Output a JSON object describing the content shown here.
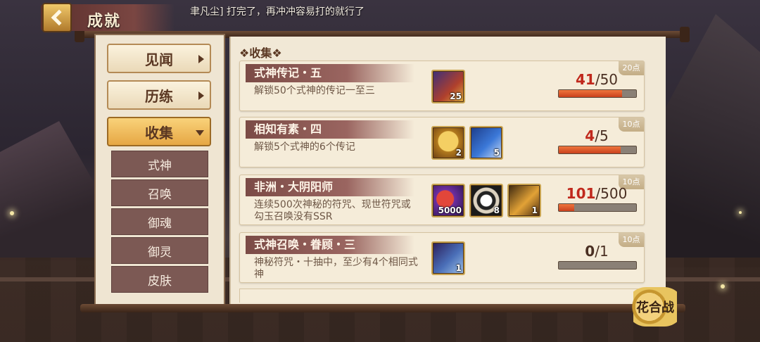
{
  "header": {
    "title": "成就",
    "ticker": "聿凡尘] 打完了，再冲冲容易打的就行了"
  },
  "nav": {
    "tabs": [
      {
        "label": "见闻"
      },
      {
        "label": "历练"
      },
      {
        "label": "收集"
      }
    ],
    "sub_items": [
      {
        "label": "式神"
      },
      {
        "label": "召唤"
      },
      {
        "label": "御魂"
      },
      {
        "label": "御灵"
      },
      {
        "label": "皮肤"
      }
    ]
  },
  "section": {
    "title": "❖收集❖"
  },
  "achievements": [
    {
      "name": "式神传记・五",
      "desc": "解锁50个式神的传记一至三",
      "points": "20点",
      "rewards": [
        {
          "icon": "biography-scroll-icon",
          "count": "25"
        }
      ],
      "progress_current": "41",
      "progress_total": "/50",
      "progress_fraction": 0.82
    },
    {
      "name": "相知有素・四",
      "desc": "解锁5个式神的6个传记",
      "points": "10点",
      "rewards": [
        {
          "icon": "lucky-daruma-icon",
          "count": "2"
        },
        {
          "icon": "mystery-charm-icon",
          "count": "5"
        }
      ],
      "progress_current": "4",
      "progress_total": "/5",
      "progress_fraction": 0.8
    },
    {
      "name": "非洲・大阴阳师",
      "desc": "连续500次神秘的符咒、现世符咒或勾玉召唤没有SSR",
      "points": "10点",
      "rewards": [
        {
          "icon": "magatama-icon",
          "count": "5000"
        },
        {
          "icon": "black-daruma-avatar-icon",
          "count": "8"
        },
        {
          "icon": "ssr-frame-icon",
          "count": "1"
        }
      ],
      "progress_current": "101",
      "progress_total": "/500",
      "progress_fraction": 0.2
    },
    {
      "name": "式神召唤・眷顾・三",
      "desc": "神秘符咒・十抽中，至少有4个相同式神",
      "points": "10点",
      "rewards": [
        {
          "icon": "ten-draw-ticket-icon",
          "count": "1"
        }
      ],
      "progress_current": "0",
      "progress_total": "/1",
      "progress_fraction": 0.0
    }
  ],
  "badge": {
    "label": "花合战"
  },
  "colors": {
    "accent": "#e6a744",
    "progress": "#d9532a",
    "card_title_bg": "#8a5752"
  }
}
